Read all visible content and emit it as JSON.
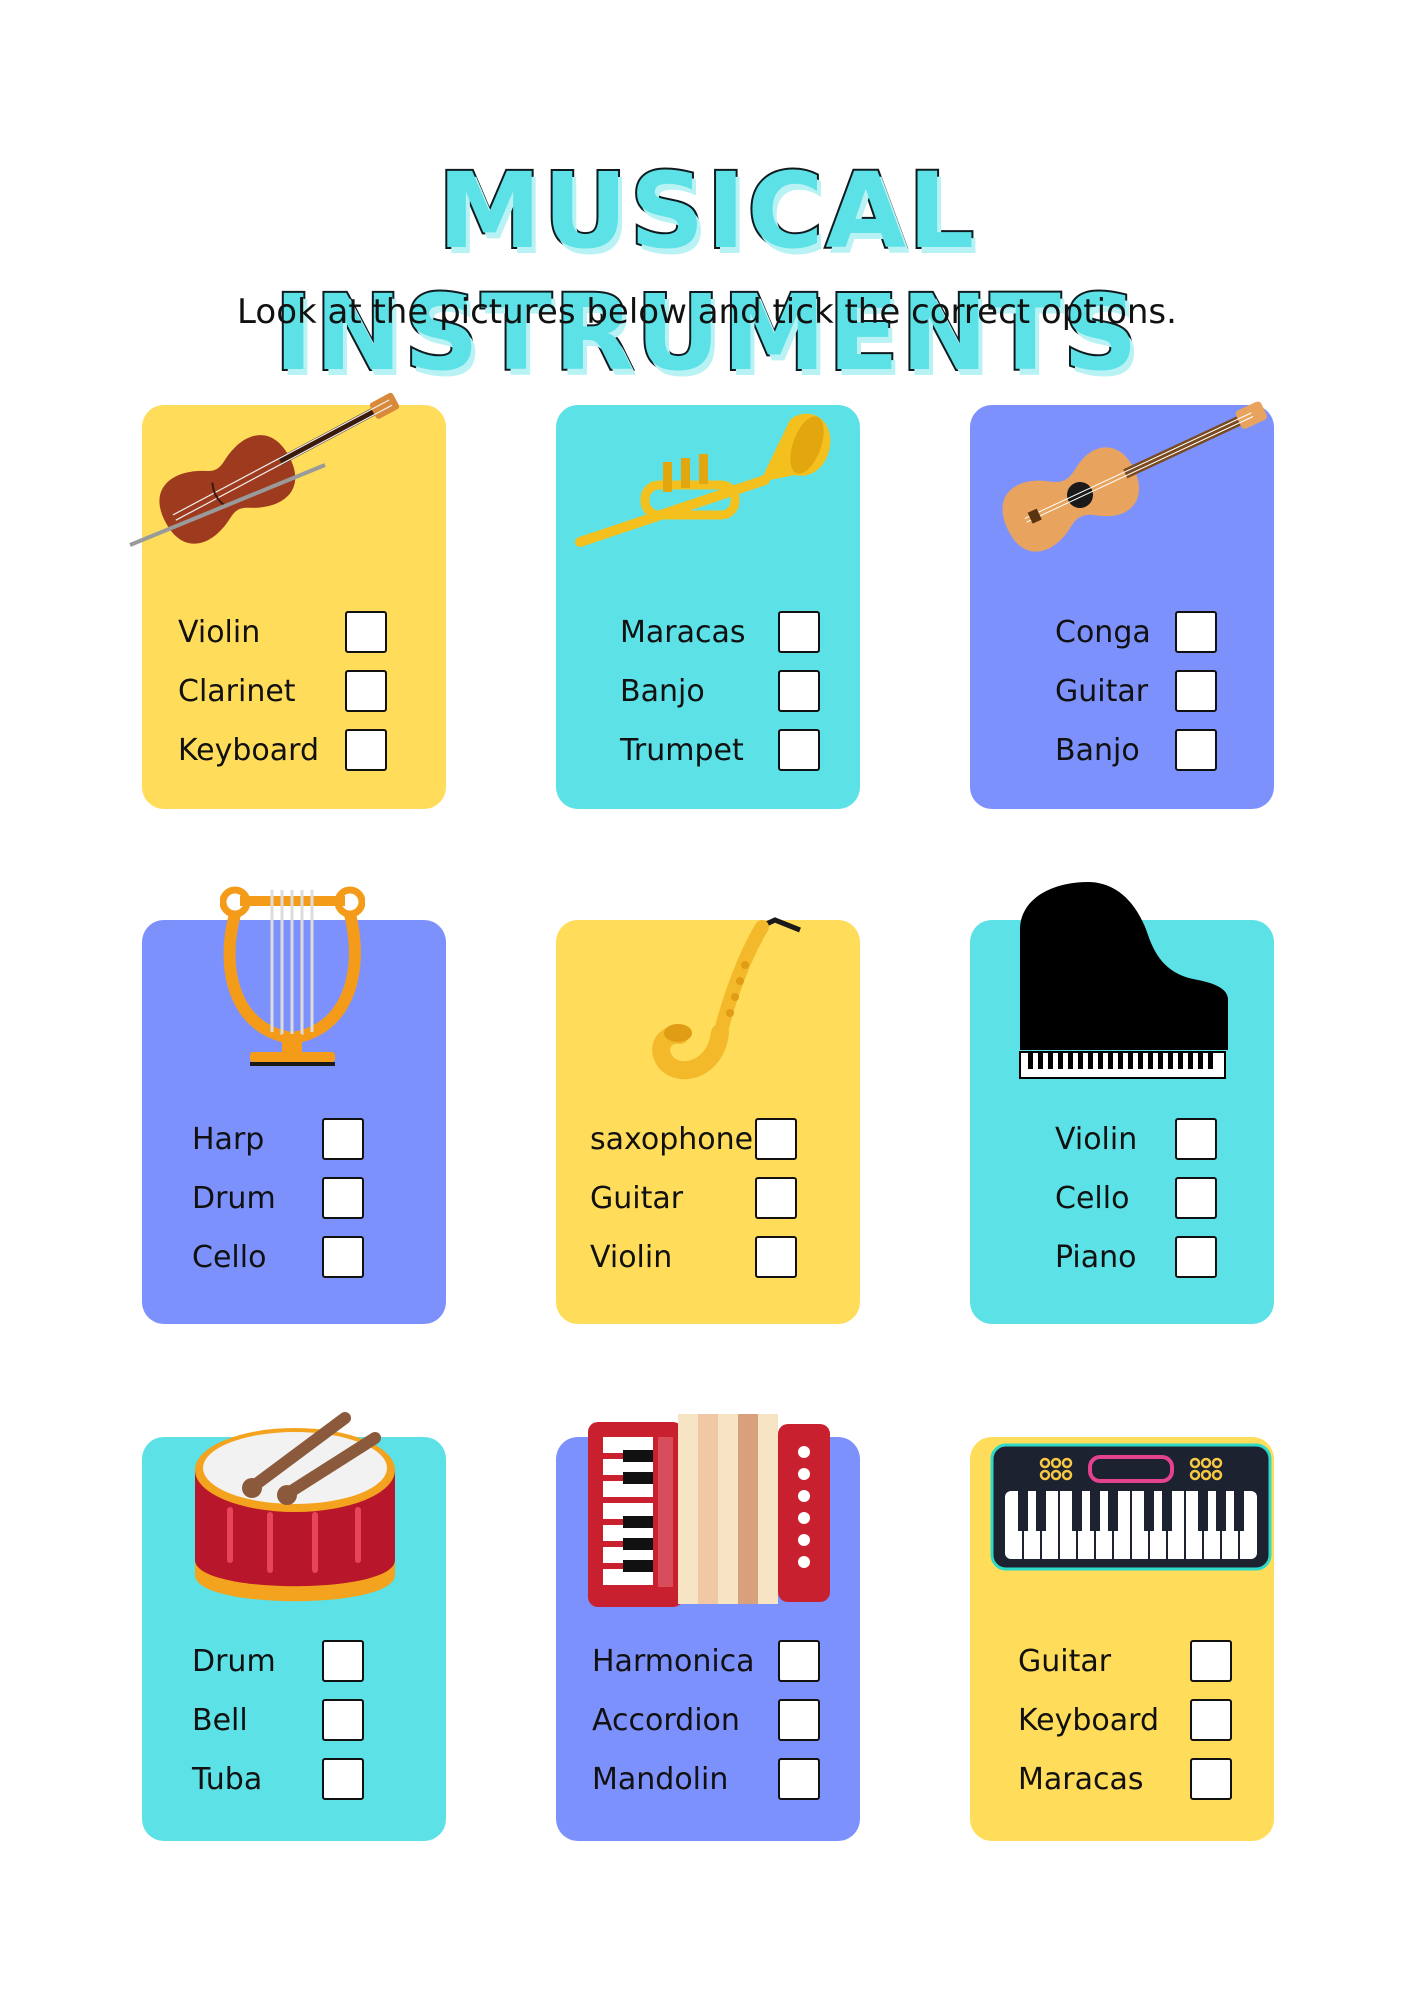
{
  "title": "MUSICAL INSTRUMENTS",
  "subtitle": "Look at the pictures below and tick the correct options.",
  "cards": [
    {
      "instrument_icon": "violin-icon",
      "color": "#FFDC59",
      "options": [
        "Violin",
        "Clarinet",
        "Keyboard"
      ]
    },
    {
      "instrument_icon": "trumpet-icon",
      "color": "#5CE1E6",
      "options": [
        "Maracas",
        "Banjo",
        "Trumpet"
      ]
    },
    {
      "instrument_icon": "guitar-icon",
      "color": "#7D91FD",
      "options": [
        "Conga",
        "Guitar",
        "Banjo"
      ]
    },
    {
      "instrument_icon": "harp-icon",
      "color": "#7D91FD",
      "options": [
        "Harp",
        "Drum",
        "Cello"
      ]
    },
    {
      "instrument_icon": "saxophone-icon",
      "color": "#FFDC59",
      "options": [
        "saxophone",
        "Guitar",
        "Violin"
      ]
    },
    {
      "instrument_icon": "piano-icon",
      "color": "#5CE1E6",
      "options": [
        "Violin",
        "Cello",
        "Piano"
      ]
    },
    {
      "instrument_icon": "drum-icon",
      "color": "#5CE1E6",
      "options": [
        "Drum",
        "Bell",
        "Tuba"
      ]
    },
    {
      "instrument_icon": "accordion-icon",
      "color": "#7D91FD",
      "options": [
        "Harmonica",
        "Accordion",
        "Mandolin"
      ]
    },
    {
      "instrument_icon": "keyboard-icon",
      "color": "#FFDC59",
      "options": [
        "Guitar",
        "Keyboard",
        "Maracas"
      ]
    }
  ]
}
